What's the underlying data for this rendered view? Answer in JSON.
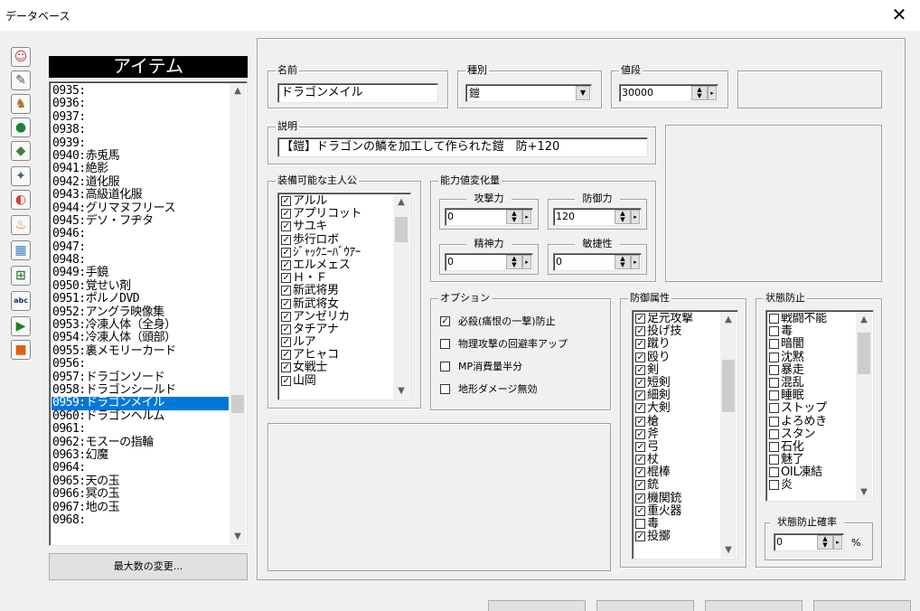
{
  "window": {
    "title": "データベース",
    "close_glyph": "✕"
  },
  "toolbar": [
    {
      "icon": "hero-icon",
      "glyph": "☺",
      "color": "#c04040"
    },
    {
      "icon": "scroll-edit-icon",
      "glyph": "✎",
      "color": "#505050"
    },
    {
      "icon": "character-edit-icon",
      "glyph": "♞",
      "color": "#b07020"
    },
    {
      "icon": "monster-icon",
      "glyph": "●",
      "color": "#208040"
    },
    {
      "icon": "monster-group-icon",
      "glyph": "◆",
      "color": "#408040"
    },
    {
      "icon": "monster-edit-icon",
      "glyph": "✦",
      "color": "#406080"
    },
    {
      "icon": "item-capsule-icon",
      "glyph": "◐",
      "color": "#d04040"
    },
    {
      "icon": "skill-fire-icon",
      "glyph": "♨",
      "color": "#e07020"
    },
    {
      "icon": "tileset-icon",
      "glyph": "▦",
      "color": "#4080c0"
    },
    {
      "icon": "system-icon",
      "glyph": "⊞",
      "color": "#408040"
    },
    {
      "icon": "text-abc-icon",
      "glyph": "abc",
      "color": "#203060"
    },
    {
      "icon": "play-icon",
      "glyph": "▶",
      "color": "#208020"
    },
    {
      "icon": "box-icon",
      "glyph": "■",
      "color": "#e06010"
    }
  ],
  "category_header": "アイテム",
  "item_list": {
    "items": [
      "0935:",
      "0936:",
      "0937:",
      "0938:",
      "0939:",
      "0940:赤兎馬",
      "0941:絶影",
      "0942:道化服",
      "0943:高級道化服",
      "0944:グリマヌフリース",
      "0945:デソ・フヂタ",
      "0946:",
      "0947:",
      "0948:",
      "0949:手鏡",
      "0950:覚せい剤",
      "0951:ポルノDVD",
      "0952:アングラ映像集",
      "0953:冷凍人体（全身）",
      "0954:冷凍人体（頭部）",
      "0955:裏メモリーカード",
      "0956:",
      "0957:ドラゴンソード",
      "0958:ドラゴンシールド",
      "0959:ドラゴンメイル",
      "0960:ドラゴンヘルム",
      "0961:",
      "0962:モスーの指輪",
      "0963:幻魔",
      "0964:",
      "0965:天の玉",
      "0966:冥の玉",
      "0967:地の玉",
      "0968:"
    ],
    "selected_index": 24,
    "scroll_position": 0.72
  },
  "max_button_label": "最大数の変更...",
  "name": {
    "label": "名前",
    "value": "ドラゴンメイル"
  },
  "type": {
    "label": "種別",
    "value": "鎧"
  },
  "price": {
    "label": "値段",
    "value": "30000"
  },
  "description": {
    "label": "説明",
    "value": "【鎧】ドラゴンの鱗を加工して作られた鎧　防+120"
  },
  "equippable": {
    "label": "装備可能な主人公",
    "items": [
      {
        "name": "アルル",
        "checked": true
      },
      {
        "name": "アプリコット",
        "checked": true
      },
      {
        "name": "サユキ",
        "checked": true
      },
      {
        "name": "歩行ロボ",
        "checked": true
      },
      {
        "name": "ｼﾞｬｯｸﾆｰﾊﾞｳｱｰ",
        "checked": true
      },
      {
        "name": "エルメェス",
        "checked": true
      },
      {
        "name": "Ｈ・Ｆ",
        "checked": true
      },
      {
        "name": "新武将男",
        "checked": true
      },
      {
        "name": "新武将女",
        "checked": true
      },
      {
        "name": "アンゼリカ",
        "checked": true
      },
      {
        "name": "タチアナ",
        "checked": true
      },
      {
        "name": "ルア",
        "checked": true
      },
      {
        "name": "アヒャコ",
        "checked": true
      },
      {
        "name": "女戦士",
        "checked": true
      },
      {
        "name": "山岡",
        "checked": true
      }
    ],
    "scroll_position": 0.05
  },
  "stats": {
    "label": "能力値変化量",
    "attack": {
      "label": "攻撃力",
      "value": "0"
    },
    "defense": {
      "label": "防御力",
      "value": "120"
    },
    "spirit": {
      "label": "精神力",
      "value": "0"
    },
    "agility": {
      "label": "敏捷性",
      "value": "0"
    }
  },
  "options": {
    "label": "オプション",
    "items": [
      {
        "label": "必殺(痛恨の一撃)防止",
        "checked": true
      },
      {
        "label": "物理攻撃の回避率アップ",
        "checked": false
      },
      {
        "label": "MP消費量半分",
        "checked": false
      },
      {
        "label": "地形ダメージ無効",
        "checked": false
      }
    ]
  },
  "defense_attributes": {
    "label": "防御属性",
    "items": [
      {
        "name": "足元攻撃",
        "checked": true
      },
      {
        "name": "投げ技",
        "checked": true
      },
      {
        "name": "蹴り",
        "checked": true
      },
      {
        "name": "殴り",
        "checked": true
      },
      {
        "name": "剣",
        "checked": true
      },
      {
        "name": "短剣",
        "checked": true
      },
      {
        "name": "細剣",
        "checked": true
      },
      {
        "name": "大剣",
        "checked": true
      },
      {
        "name": "槍",
        "checked": true
      },
      {
        "name": "斧",
        "checked": true
      },
      {
        "name": "弓",
        "checked": true
      },
      {
        "name": "杖",
        "checked": true
      },
      {
        "name": "棍棒",
        "checked": true
      },
      {
        "name": "銃",
        "checked": true
      },
      {
        "name": "機関銃",
        "checked": true
      },
      {
        "name": "重火器",
        "checked": true
      },
      {
        "name": "毒",
        "checked": false
      },
      {
        "name": "投擲",
        "checked": true
      }
    ],
    "scroll_position": 0.2
  },
  "status_prevention": {
    "label": "状態防止",
    "items": [
      {
        "name": "戦闘不能",
        "checked": false
      },
      {
        "name": "毒",
        "checked": false
      },
      {
        "name": "暗闇",
        "checked": false
      },
      {
        "name": "沈黙",
        "checked": false
      },
      {
        "name": "暴走",
        "checked": false
      },
      {
        "name": "混乱",
        "checked": false
      },
      {
        "name": "睡眠",
        "checked": false
      },
      {
        "name": "ストップ",
        "checked": false
      },
      {
        "name": "よろめき",
        "checked": false
      },
      {
        "name": "スタン",
        "checked": false
      },
      {
        "name": "石化",
        "checked": false
      },
      {
        "name": "魅了",
        "checked": false
      },
      {
        "name": "OIL凍結",
        "checked": false
      },
      {
        "name": "炎",
        "checked": false
      }
    ],
    "scroll_position": 0.05,
    "rate": {
      "label": "状態防止確率",
      "value": "0",
      "unit": "%"
    }
  }
}
